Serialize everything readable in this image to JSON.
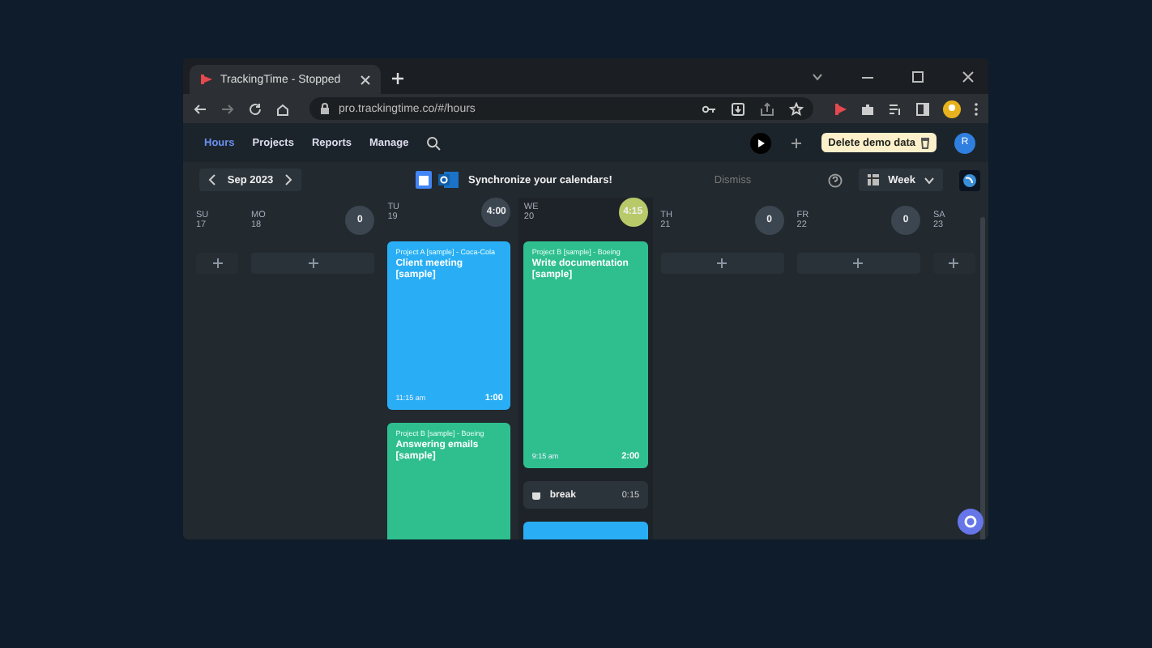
{
  "browser": {
    "tab_title": "TrackingTime - Stopped",
    "url": "pro.trackingtime.co/#/hours"
  },
  "nav": {
    "items": [
      {
        "label": "Hours",
        "selected": true
      },
      {
        "label": "Projects",
        "selected": false
      },
      {
        "label": "Reports",
        "selected": false
      },
      {
        "label": "Manage",
        "selected": false
      }
    ],
    "demo_button": "Delete demo data",
    "avatar": "R"
  },
  "toolbar": {
    "month": "Sep 2023",
    "sync_text": "Synchronize your calendars!",
    "dismiss": "Dismiss",
    "view": "Week"
  },
  "days": [
    {
      "name": "SU",
      "date": "17",
      "narrow": true,
      "selected": false
    },
    {
      "name": "MO",
      "date": "18",
      "narrow": false,
      "selected": false,
      "total": "0"
    },
    {
      "name": "TU",
      "date": "19",
      "narrow": false,
      "selected": false,
      "total": "4:00",
      "entries": [
        {
          "kind": "task",
          "color": "#29aef5",
          "project": "Project A [sample] - Coca-Cola",
          "title": "Client meeting [sample]",
          "start": "11:15 am",
          "duration": "1:00"
        },
        {
          "kind": "task",
          "color": "#2fbf8f",
          "project": "Project B [sample] - Boeing",
          "title": "Answering emails [sample]"
        }
      ]
    },
    {
      "name": "WE",
      "date": "20",
      "narrow": false,
      "selected": true,
      "total": "4:15",
      "entries": [
        {
          "kind": "task",
          "color": "#2fbf8f",
          "project": "Project B [sample] - Boeing",
          "title": "Write documentation [sample]",
          "start": "9:15 am",
          "duration": "2:00"
        },
        {
          "kind": "break",
          "title": "break",
          "duration": "0:15"
        },
        {
          "kind": "task",
          "color": "#29aef5"
        }
      ]
    },
    {
      "name": "TH",
      "date": "21",
      "narrow": false,
      "selected": false,
      "total": "0"
    },
    {
      "name": "FR",
      "date": "22",
      "narrow": false,
      "selected": false,
      "total": "0"
    },
    {
      "name": "SA",
      "date": "23",
      "narrow": true,
      "selected": false
    }
  ]
}
